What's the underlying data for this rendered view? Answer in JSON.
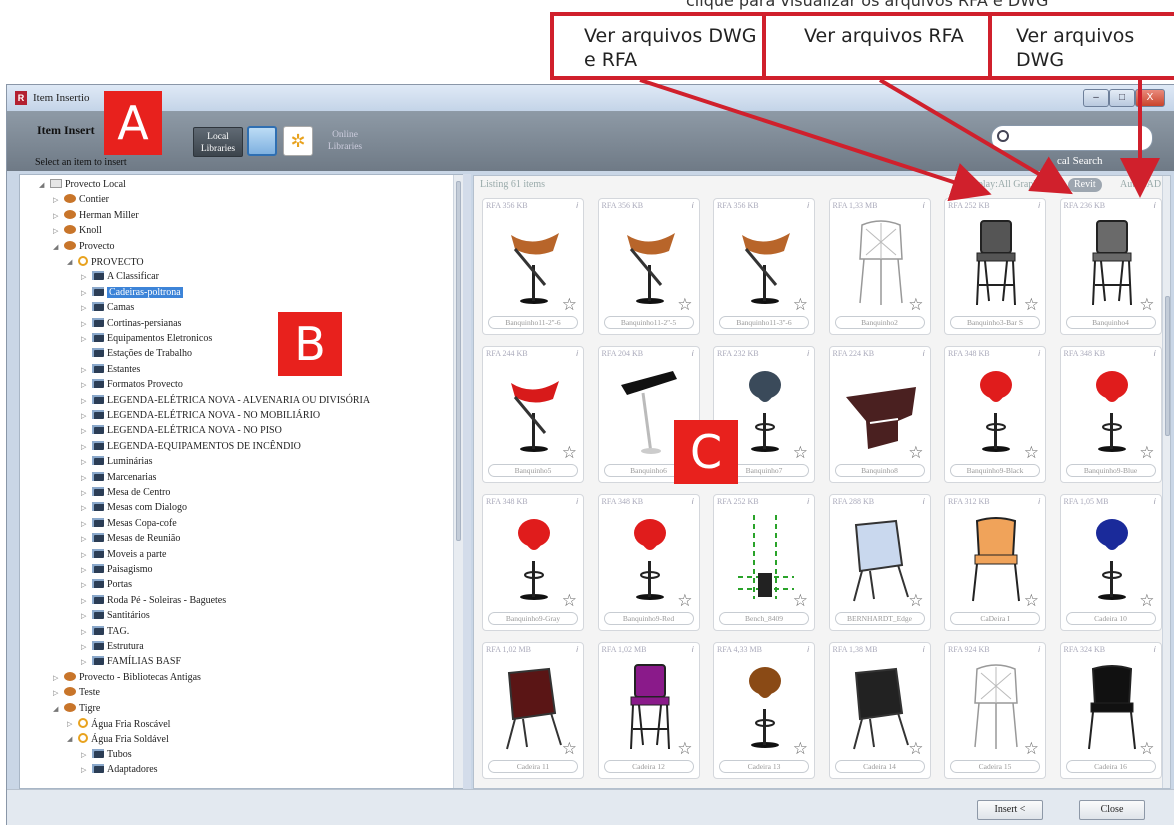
{
  "top_caption": "clique para visualizar os arquivos RFA e DWG",
  "callouts": [
    {
      "text": "Ver arquivos DWG e RFA"
    },
    {
      "text": "Ver arquivos RFA"
    },
    {
      "text": "Ver arquivos DWG"
    }
  ],
  "markers": {
    "a": "A",
    "b": "B",
    "c": "C"
  },
  "accent_color": "#d0202c",
  "window": {
    "title": "Item Insertio",
    "controls": [
      "–",
      "□",
      "X"
    ]
  },
  "toolbar": {
    "title": "Item Insert",
    "subtitle": "Select an item to insert",
    "local_label": "Local Libraries",
    "online_label": "Online Libraries",
    "search_placeholder": "",
    "search_sub": "cal Search"
  },
  "tree": [
    {
      "label": "Provecto Local",
      "icon": "root",
      "exp": "◢"
    },
    {
      "label": "Contier",
      "icon": "lib",
      "exp": "▷"
    },
    {
      "label": "Herman Miller",
      "icon": "lib",
      "exp": "▷"
    },
    {
      "label": "Knoll",
      "icon": "lib",
      "exp": "▷"
    },
    {
      "label": "Provecto",
      "icon": "lib",
      "exp": "◢"
    },
    {
      "label": "PROVECTO",
      "icon": "gear",
      "exp": "◢"
    },
    {
      "label": "A Classificar",
      "icon": "folder",
      "exp": "▷"
    },
    {
      "label": "Cadeiras-poltrona",
      "icon": "folder",
      "exp": "▷",
      "selected": true
    },
    {
      "label": "Camas",
      "icon": "folder",
      "exp": "▷"
    },
    {
      "label": "Cortinas-persianas",
      "icon": "folder",
      "exp": "▷"
    },
    {
      "label": "Equipamentos Eletronicos",
      "icon": "folder",
      "exp": "▷"
    },
    {
      "label": "Estações de Trabalho",
      "icon": "folder",
      "exp": ""
    },
    {
      "label": "Estantes",
      "icon": "folder",
      "exp": "▷"
    },
    {
      "label": "Formatos Provecto",
      "icon": "folder",
      "exp": "▷"
    },
    {
      "label": "LEGENDA-ELÉTRICA NOVA - ALVENARIA OU DIVISÓRIA",
      "icon": "folder",
      "exp": "▷"
    },
    {
      "label": "LEGENDA-ELÉTRICA NOVA - NO MOBILIÁRIO",
      "icon": "folder",
      "exp": "▷"
    },
    {
      "label": "LEGENDA-ELÉTRICA NOVA - NO PISO",
      "icon": "folder",
      "exp": "▷"
    },
    {
      "label": "LEGENDA-EQUIPAMENTOS DE INCÊNDIO",
      "icon": "folder",
      "exp": "▷"
    },
    {
      "label": "Luminárias",
      "icon": "folder",
      "exp": "▷"
    },
    {
      "label": "Marcenarias",
      "icon": "folder",
      "exp": "▷"
    },
    {
      "label": "Mesa de Centro",
      "icon": "folder",
      "exp": "▷"
    },
    {
      "label": "Mesas com Dialogo",
      "icon": "folder",
      "exp": "▷"
    },
    {
      "label": "Mesas Copa-cofe",
      "icon": "folder",
      "exp": "▷"
    },
    {
      "label": "Mesas de Reunião",
      "icon": "folder",
      "exp": "▷"
    },
    {
      "label": "Moveis a parte",
      "icon": "folder",
      "exp": "▷"
    },
    {
      "label": "Paisagismo",
      "icon": "folder",
      "exp": "▷"
    },
    {
      "label": "Portas",
      "icon": "folder",
      "exp": "▷"
    },
    {
      "label": "Roda Pé - Soleiras - Baguetes",
      "icon": "folder",
      "exp": "▷"
    },
    {
      "label": "Santitários",
      "icon": "folder",
      "exp": "▷"
    },
    {
      "label": "TAG.",
      "icon": "folder",
      "exp": "▷"
    },
    {
      "label": "Estrutura",
      "icon": "folder",
      "exp": "▷"
    },
    {
      "label": "FAMÍLIAS BASF",
      "icon": "folder",
      "exp": "▷"
    },
    {
      "label": "Provecto - Bibliotecas Antigas",
      "icon": "lib",
      "exp": "▷"
    },
    {
      "label": "Teste",
      "icon": "lib",
      "exp": "▷"
    },
    {
      "label": "Tigre",
      "icon": "lib",
      "exp": "◢"
    },
    {
      "label": "Água Fria Roscável",
      "icon": "gear",
      "exp": "▷"
    },
    {
      "label": "Água Fria Soldável",
      "icon": "gear",
      "exp": "◢"
    },
    {
      "label": "Tubos",
      "icon": "folder",
      "exp": "▷"
    },
    {
      "label": "Adaptadores",
      "icon": "folder",
      "exp": "▷"
    }
  ],
  "listing": {
    "count_text": "Listing 61 items",
    "display_label": "Display:",
    "filters": [
      {
        "label": "All Graphics",
        "active": false
      },
      {
        "label": "Revit",
        "active": true
      },
      {
        "label": "AutoCAD",
        "active": false
      }
    ]
  },
  "items": [
    {
      "meta": "RFA 356 KB",
      "name": "Banquinho11-2''-6",
      "color": "#b8652a",
      "kind": "stool"
    },
    {
      "meta": "RFA 356 KB",
      "name": "Banquinho11-2''-5",
      "color": "#b8652a",
      "kind": "stool"
    },
    {
      "meta": "RFA 356 KB",
      "name": "Banquinho11-3''-6",
      "color": "#b8652a",
      "kind": "stool"
    },
    {
      "meta": "RFA 1,33 MB",
      "name": "Banquinho2",
      "color": "#d8d8d8",
      "kind": "wire"
    },
    {
      "meta": "RFA 252 KB",
      "name": "Banquinho3-Bar S",
      "color": "#555",
      "kind": "bar"
    },
    {
      "meta": "RFA 236 KB",
      "name": "Banquinho4",
      "color": "#6a6a6a",
      "kind": "bar"
    },
    {
      "meta": "RFA 244 KB",
      "name": "Banquinho5",
      "color": "#d81a1a",
      "kind": "stool"
    },
    {
      "meta": "RFA 204 KB",
      "name": "Banquinho6",
      "color": "#111",
      "kind": "zig"
    },
    {
      "meta": "RFA 232 KB",
      "name": "Banquinho7",
      "color": "#3a4a5a",
      "kind": "round"
    },
    {
      "meta": "RFA 224 KB",
      "name": "Banquinho8",
      "color": "#4a2020",
      "kind": "bench"
    },
    {
      "meta": "RFA 348 KB",
      "name": "Banquinho9-Black",
      "color": "#e01c1c",
      "kind": "round"
    },
    {
      "meta": "RFA 348 KB",
      "name": "Banquinho9-Blue",
      "color": "#e01c1c",
      "kind": "round"
    },
    {
      "meta": "RFA 348 KB",
      "name": "Banquinho9-Gray",
      "color": "#e01c1c",
      "kind": "round"
    },
    {
      "meta": "RFA 348 KB",
      "name": "Banquinho9-Red",
      "color": "#e01c1c",
      "kind": "round"
    },
    {
      "meta": "RFA 252 KB",
      "name": "Bench_8409",
      "color": "#2aa32a",
      "kind": "dashed"
    },
    {
      "meta": "RFA 288 KB",
      "name": "BERNHARDT_Edge",
      "color": "#c9d8ee",
      "kind": "lounge"
    },
    {
      "meta": "RFA 312 KB",
      "name": "CaDeira I",
      "color": "#f0a35a",
      "kind": "chair"
    },
    {
      "meta": "RFA 1,05 MB",
      "name": "Cadeira 10",
      "color": "#1a2a9a",
      "kind": "round"
    },
    {
      "meta": "RFA 1,02 MB",
      "name": "Cadeira 11",
      "color": "#5a1515",
      "kind": "lounge"
    },
    {
      "meta": "RFA 1,02 MB",
      "name": "Cadeira 12",
      "color": "#8a1a8a",
      "kind": "bar"
    },
    {
      "meta": "RFA 4,33 MB",
      "name": "Cadeira 13",
      "color": "#8a4a15",
      "kind": "round"
    },
    {
      "meta": "RFA 1,38 MB",
      "name": "Cadeira 14",
      "color": "#222",
      "kind": "lounge"
    },
    {
      "meta": "RFA 924 KB",
      "name": "Cadeira 15",
      "color": "#ddd",
      "kind": "wire"
    },
    {
      "meta": "RFA 324 KB",
      "name": "Cadeira 16",
      "color": "#111",
      "kind": "chair"
    }
  ],
  "buttons": {
    "insert": "Insert <",
    "close": "Close"
  }
}
